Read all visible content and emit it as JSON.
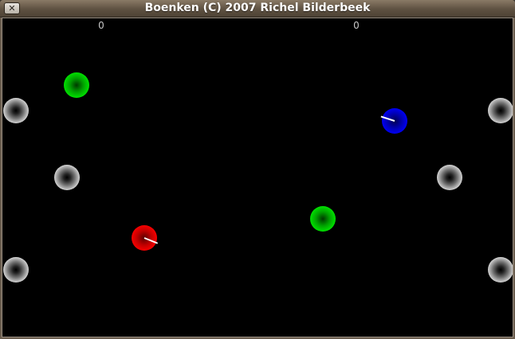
{
  "window": {
    "title": "Boenken (C) 2007 Richel Bilderbeek",
    "close_glyph": "✕"
  },
  "scores": {
    "player_1": "0",
    "player_2": "0"
  },
  "colors": {
    "playfield_background": "#000000",
    "player_1": "#ff0000",
    "player_2": "#0000ff",
    "goal_balls": "#00ff00",
    "obstacles": "#ffffff"
  }
}
